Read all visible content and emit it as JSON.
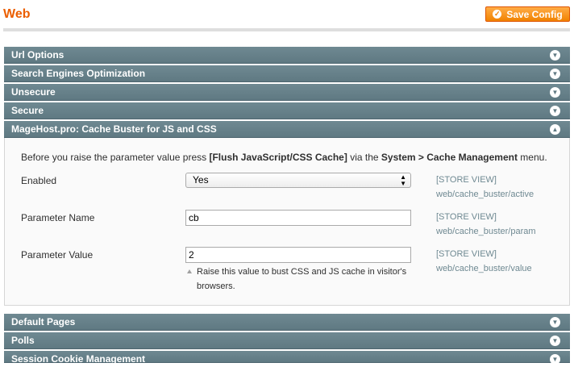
{
  "page": {
    "title": "Web",
    "save_button": "Save Config"
  },
  "sections": [
    {
      "label": "Url Options",
      "state": "collapsed"
    },
    {
      "label": "Search Engines Optimization",
      "state": "collapsed"
    },
    {
      "label": "Unsecure",
      "state": "collapsed"
    },
    {
      "label": "Secure",
      "state": "collapsed"
    },
    {
      "label": "MageHost.pro: Cache Buster for JS and CSS",
      "state": "expanded"
    },
    {
      "label": "Default Pages",
      "state": "collapsed"
    },
    {
      "label": "Polls",
      "state": "collapsed"
    },
    {
      "label": "Session Cookie Management",
      "state": "collapsed"
    }
  ],
  "cache_buster": {
    "intro": {
      "before": "Before you raise the parameter value press ",
      "button_ref": "[Flush JavaScript/CSS Cache]",
      "middle": " via the ",
      "menu_ref": "System > Cache Management",
      "after": " menu."
    },
    "fields": {
      "enabled": {
        "label": "Enabled",
        "value": "Yes",
        "scope": "[STORE VIEW]",
        "path": "web/cache_buster/active"
      },
      "param_name": {
        "label": "Parameter Name",
        "value": "cb",
        "scope": "[STORE VIEW]",
        "path": "web/cache_buster/param"
      },
      "param_value": {
        "label": "Parameter Value",
        "value": "2",
        "scope": "[STORE VIEW]",
        "path": "web/cache_buster/value",
        "note_line1": "Raise this value to bust CSS and JS cache in visitor's",
        "note_line2": "browsers."
      }
    }
  },
  "colors": {
    "title": "#eb5e00",
    "save_button": "#f18200",
    "section_bar": "#6f8992",
    "scope_text": "#6f8992"
  },
  "icons": {
    "save": "check-circle-icon",
    "collapsed": "chevron-down-circle-icon",
    "expanded": "chevron-up-circle-icon",
    "select": "select-arrows-icon",
    "note": "triangle-up-icon"
  }
}
